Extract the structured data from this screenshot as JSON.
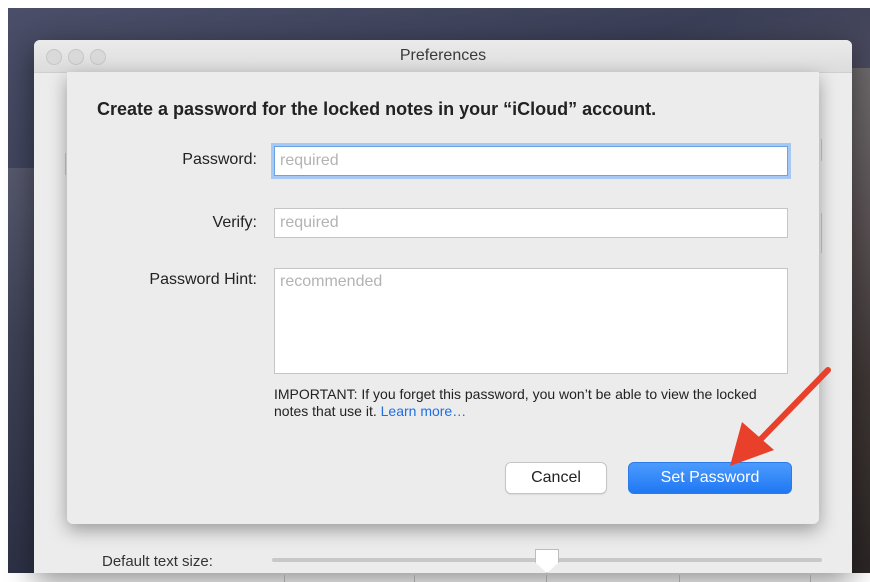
{
  "window": {
    "title": "Preferences",
    "background_label": "Default text size:"
  },
  "sheet": {
    "title": "Create a password for the locked notes in your “iCloud” account.",
    "fields": {
      "password": {
        "label": "Password:",
        "placeholder": "required",
        "value": ""
      },
      "verify": {
        "label": "Verify:",
        "placeholder": "required",
        "value": ""
      },
      "hint": {
        "label": "Password Hint:",
        "placeholder": "recommended",
        "value": ""
      }
    },
    "important_text": "IMPORTANT: If you forget this password, you won’t be able to view the locked notes that use it.",
    "learn_more_label": "Learn more…",
    "buttons": {
      "cancel_label": "Cancel",
      "set_password_label": "Set Password"
    }
  },
  "colors": {
    "primary_button": "#1f78f2",
    "focus_ring": "#a6c8f2",
    "link": "#1f6fe0",
    "annotation_arrow": "#e8402a"
  },
  "annotation": {
    "arrow_icon": "red-arrow-icon"
  }
}
